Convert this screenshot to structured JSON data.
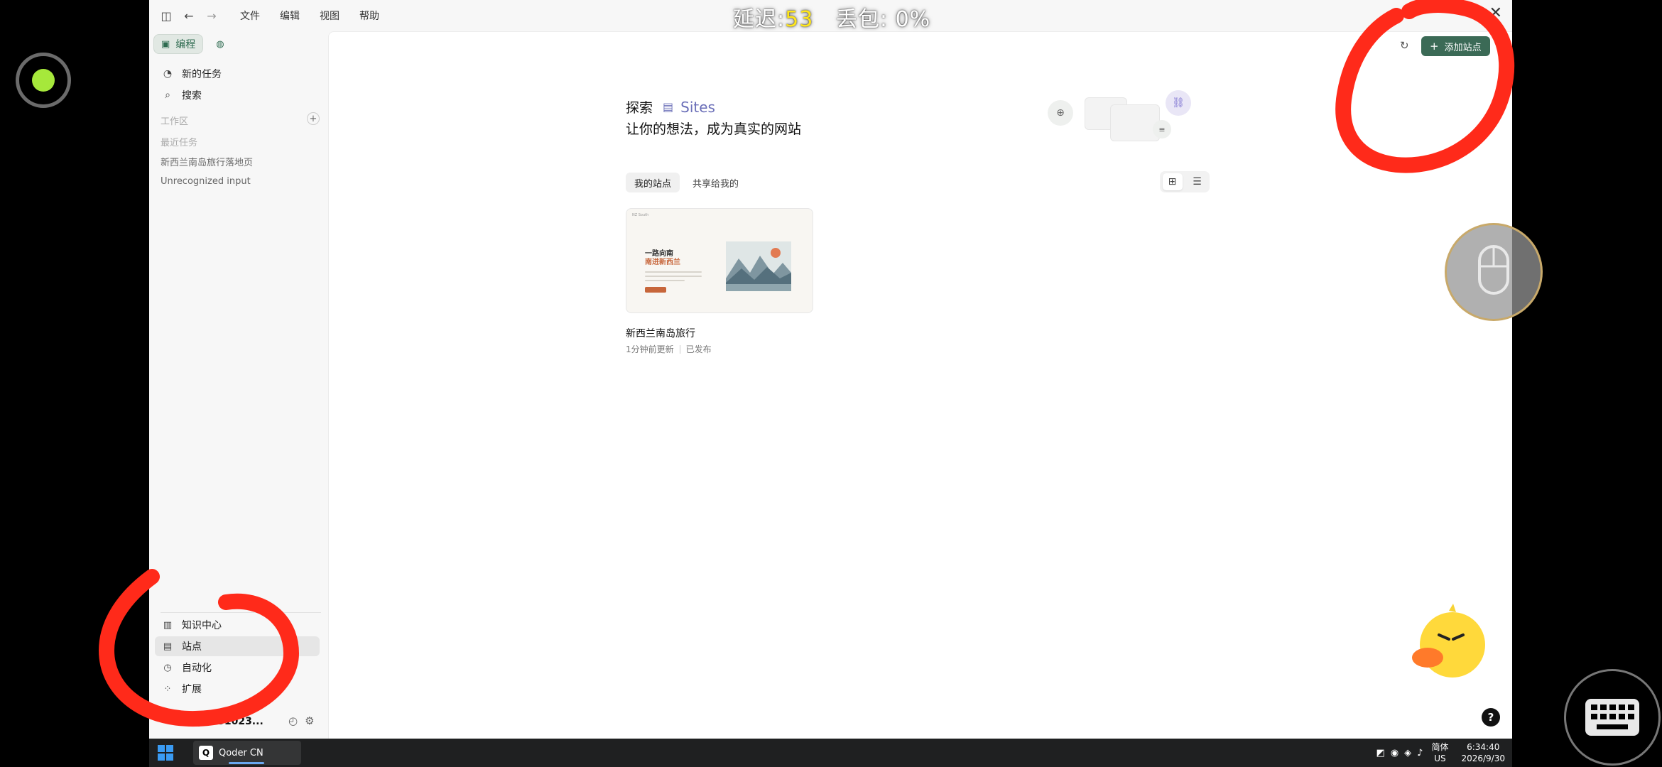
{
  "titlebar": {
    "menus": [
      "文件",
      "编辑",
      "视图",
      "帮助"
    ],
    "latency_label": "延迟:",
    "latency_value": "53",
    "loss_label": "丢包:",
    "loss_value": "0%"
  },
  "sidebar": {
    "modes": [
      {
        "label": "编程",
        "icon": "code-panel-icon"
      },
      {
        "label": "",
        "icon": "shapes-icon"
      }
    ],
    "new_task": "新的任务",
    "search": "搜索",
    "workspace_label": "工作区",
    "recent_label": "最近任务",
    "recent_items": [
      "新西兰南岛旅行落地页",
      "Unrecognized input"
    ],
    "bottom_items": [
      {
        "label": "知识中心",
        "icon": "book-icon"
      },
      {
        "label": "站点",
        "icon": "site-icon",
        "selected": true
      },
      {
        "label": "自动化",
        "icon": "automation-icon"
      },
      {
        "label": "扩展",
        "icon": "extensions-icon"
      }
    ],
    "user": "aliyun51023..."
  },
  "main": {
    "add_site": "添加站点",
    "explore_prefix": "探索",
    "explore_brand": "Sites",
    "tagline": "让你的想法，成为真实的网站",
    "tabs": [
      {
        "label": "我的站点",
        "active": true
      },
      {
        "label": "共享给我的",
        "active": false
      }
    ],
    "site": {
      "preview_brand": "NZ South",
      "preview_title_line1": "一路向南",
      "preview_title_line2": "南进新西兰",
      "name": "新西兰南岛旅行",
      "updated": "1分钟前更新",
      "status": "已发布"
    },
    "help": "?"
  },
  "taskbar": {
    "app_name": "Qoder CN",
    "ime": "简体",
    "locale": "US",
    "time": "6:34:40",
    "date": "2026/9/30"
  },
  "colors": {
    "accent_green": "#3b6a56",
    "brand_purple": "#6b6fb8",
    "annotation_red": "#ff2a1a",
    "latency_yellow": "#ffe61a"
  }
}
